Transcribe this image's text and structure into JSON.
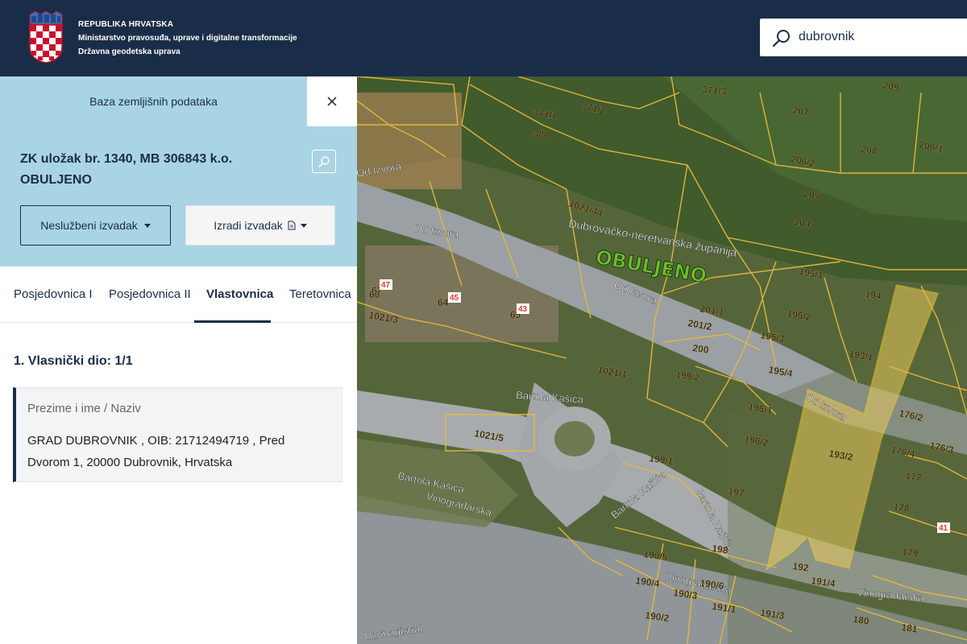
{
  "header": {
    "org_line1": "REPUBLIKA HRVATSKA",
    "org_line2": "Ministarstvo pravosuđa, uprave i digitalne transformacije",
    "org_line3": "Državna geodetska uprava",
    "logo_icon": "croatian-coat-of-arms-icon",
    "search_value": "dubrovnik",
    "search_icon": "search-icon"
  },
  "panel": {
    "title": "Baza zemljišnih podataka",
    "close_icon": "close-icon",
    "record_title": "ZK uložak br. 1340, MB 306843 k.o. OBULJENO",
    "zoom_icon": "search-icon",
    "btn_unofficial": "Neslužbeni izvadak",
    "btn_create": "Izradi izvadak",
    "btn_create_icon": "document-icon",
    "tabs": [
      {
        "label": "Posjedovnica I"
      },
      {
        "label": "Posjedovnica II"
      },
      {
        "label": "Vlastovnica"
      },
      {
        "label": "Teretovnica"
      }
    ],
    "active_tab": "Vlastovnica",
    "section_title": "1. Vlasnički dio: 1/1",
    "owner_label": "Prezime i ime / Naziv",
    "owner_value": "GRAD DUBROVNIK , OIB: 21712494719 , Pred Dvorom 1, 20000 Dubrovnik, Hrvatska"
  },
  "map": {
    "area_label": "OBULJENO",
    "region_label": "Dubrovačko-neretvanska županija",
    "streets": [
      "Od Izvora",
      "Od Izvora",
      "Od Izvora",
      "Bartola Kašića",
      "Bartola Kašića",
      "Bartola Kašića",
      "Vinogradarska",
      "Vinogradarska",
      "Vinogradarska",
      "Uz magistral"
    ],
    "parcels": [
      "371/3",
      "371/2",
      "371/1",
      "380",
      "209",
      "207",
      "208",
      "206/1",
      "206/2",
      "205",
      "204",
      "1021/44",
      "195/1",
      "194",
      "201/1",
      "201/2",
      "196/2",
      "195/3",
      "193/1",
      "200",
      "199/2",
      "195/4",
      "1021/1",
      "196/1",
      "176/2",
      "176/4",
      "176/3",
      "196/2",
      "193/2",
      "177",
      "1021/3",
      "1021/5",
      "199/1",
      "197",
      "178",
      "179",
      "198",
      "190/5",
      "192",
      "191/4",
      "190/4",
      "190/3",
      "190/6",
      "190/2",
      "191/1",
      "191/3",
      "180",
      "181",
      "67",
      "66",
      "64",
      "65"
    ],
    "house_numbers": [
      "47",
      "45",
      "43",
      "41"
    ],
    "colors": {
      "parcel_line": "#e8b93a",
      "selected_fill": "#e8c85a",
      "selected_line": "#f4d23c",
      "header_bg": "#1a2d48",
      "panel_bg": "#a9d4e4",
      "house_number": "#e53935"
    }
  }
}
